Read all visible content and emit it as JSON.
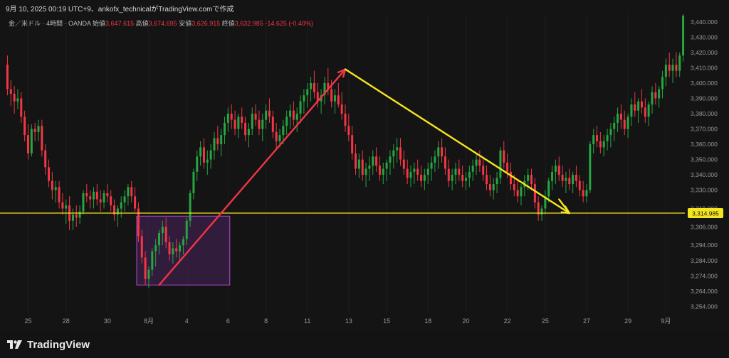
{
  "header": {
    "caption": "9月 10, 2025 00:19 UTC+9、ankofx_technicalがTradingView.comで作成"
  },
  "legend": {
    "symbol": "金／米ドル · 4時間 · OANDA",
    "open_label": "始値",
    "open": "3,647.615",
    "high_label": "高値",
    "high": "3,674.695",
    "low_label": "安値",
    "low": "3,626.915",
    "close_label": "終値",
    "close": "3,632.985",
    "change": "-14.625 (-0.40%)"
  },
  "footer": {
    "brand": "TradingView"
  },
  "colors": {
    "background": "#141414",
    "up": "#26a641",
    "down": "#f23645",
    "hline": "#f5e51f",
    "rise_arrow": "#f23645",
    "fall_arrow": "#f5e51f",
    "box_stroke": "#b04bd6",
    "box_fill": "#6a2a86"
  },
  "chart_data": {
    "type": "candlestick",
    "symbol": "XAUUSD",
    "timeframe": "4H",
    "ylim": [
      3250,
      3445
    ],
    "y_ticks": [
      "3,440.000",
      "3,430.000",
      "3,420.000",
      "3,410.000",
      "3,400.000",
      "3,390.000",
      "3,380.000",
      "3,370.000",
      "3,360.000",
      "3,350.000",
      "3,340.000",
      "3,330.000",
      "3,318.000",
      "3,306.000",
      "3,294.000",
      "3,284.000",
      "3,274.000",
      "3,264.000",
      "3,254.000"
    ],
    "x_ticks": [
      "25",
      "28",
      "30",
      "8月",
      "4",
      "6",
      "8",
      "11",
      "13",
      "15",
      "18",
      "20",
      "22",
      "25",
      "27",
      "29",
      "9月"
    ],
    "horizontal_line": {
      "value": 3314.985,
      "label": "3,314.985"
    },
    "highlight_box": {
      "from_candle": 38,
      "to_candle": 64,
      "y_from": 3268,
      "y_to": 3313
    },
    "arrows": [
      {
        "kind": "rise",
        "from_candle": 44,
        "from_value": 3268,
        "to_candle": 98,
        "to_value": 3409
      },
      {
        "kind": "fall",
        "from_candle": 98,
        "from_value": 3409,
        "to_candle": 163,
        "to_value": 3315
      },
      {
        "kind": "hook",
        "from_candle": 160,
        "from_value": 3324,
        "to_candle": 163,
        "to_value": 3315
      }
    ],
    "candles": [
      [
        3412,
        3418,
        3392,
        3396
      ],
      [
        3396,
        3402,
        3385,
        3393
      ],
      [
        3393,
        3398,
        3380,
        3388
      ],
      [
        3388,
        3396,
        3383,
        3390
      ],
      [
        3390,
        3394,
        3374,
        3378
      ],
      [
        3378,
        3382,
        3362,
        3366
      ],
      [
        3366,
        3373,
        3350,
        3354
      ],
      [
        3354,
        3373,
        3352,
        3370
      ],
      [
        3370,
        3374,
        3362,
        3368
      ],
      [
        3368,
        3376,
        3362,
        3372
      ],
      [
        3372,
        3376,
        3352,
        3356
      ],
      [
        3356,
        3360,
        3340,
        3345
      ],
      [
        3345,
        3350,
        3332,
        3336
      ],
      [
        3336,
        3342,
        3324,
        3330
      ],
      [
        3330,
        3336,
        3322,
        3332
      ],
      [
        3332,
        3336,
        3318,
        3322
      ],
      [
        3322,
        3328,
        3314,
        3318
      ],
      [
        3318,
        3324,
        3308,
        3320
      ],
      [
        3320,
        3326,
        3304,
        3310
      ],
      [
        3310,
        3318,
        3304,
        3314
      ],
      [
        3314,
        3320,
        3306,
        3312
      ],
      [
        3312,
        3320,
        3308,
        3316
      ],
      [
        3316,
        3330,
        3314,
        3328
      ],
      [
        3328,
        3334,
        3322,
        3326
      ],
      [
        3326,
        3330,
        3318,
        3324
      ],
      [
        3324,
        3332,
        3318,
        3329
      ],
      [
        3329,
        3334,
        3320,
        3324
      ],
      [
        3324,
        3330,
        3316,
        3322
      ],
      [
        3322,
        3330,
        3318,
        3328
      ],
      [
        3328,
        3334,
        3322,
        3326
      ],
      [
        3326,
        3330,
        3316,
        3320
      ],
      [
        3320,
        3324,
        3310,
        3314
      ],
      [
        3314,
        3320,
        3306,
        3318
      ],
      [
        3318,
        3326,
        3312,
        3322
      ],
      [
        3322,
        3330,
        3316,
        3326
      ],
      [
        3326,
        3334,
        3320,
        3332
      ],
      [
        3332,
        3336,
        3322,
        3326
      ],
      [
        3326,
        3332,
        3316,
        3318
      ],
      [
        3318,
        3322,
        3296,
        3300
      ],
      [
        3300,
        3304,
        3282,
        3286
      ],
      [
        3286,
        3290,
        3268,
        3272
      ],
      [
        3272,
        3280,
        3266,
        3278
      ],
      [
        3278,
        3292,
        3274,
        3290
      ],
      [
        3290,
        3298,
        3280,
        3294
      ],
      [
        3294,
        3304,
        3288,
        3302
      ],
      [
        3302,
        3310,
        3294,
        3306
      ],
      [
        3306,
        3312,
        3292,
        3296
      ],
      [
        3296,
        3300,
        3284,
        3288
      ],
      [
        3288,
        3296,
        3282,
        3292
      ],
      [
        3292,
        3298,
        3286,
        3290
      ],
      [
        3290,
        3296,
        3284,
        3294
      ],
      [
        3294,
        3300,
        3288,
        3298
      ],
      [
        3298,
        3312,
        3294,
        3310
      ],
      [
        3310,
        3330,
        3306,
        3328
      ],
      [
        3328,
        3344,
        3324,
        3342
      ],
      [
        3342,
        3356,
        3336,
        3352
      ],
      [
        3352,
        3362,
        3346,
        3358
      ],
      [
        3358,
        3364,
        3344,
        3348
      ],
      [
        3348,
        3356,
        3340,
        3350
      ],
      [
        3350,
        3360,
        3344,
        3356
      ],
      [
        3356,
        3368,
        3350,
        3364
      ],
      [
        3364,
        3372,
        3356,
        3360
      ],
      [
        3360,
        3370,
        3352,
        3366
      ],
      [
        3366,
        3378,
        3360,
        3374
      ],
      [
        3374,
        3384,
        3368,
        3380
      ],
      [
        3380,
        3386,
        3370,
        3376
      ],
      [
        3376,
        3382,
        3366,
        3370
      ],
      [
        3370,
        3380,
        3364,
        3378
      ],
      [
        3378,
        3384,
        3370,
        3374
      ],
      [
        3374,
        3378,
        3362,
        3366
      ],
      [
        3366,
        3374,
        3358,
        3370
      ],
      [
        3370,
        3384,
        3366,
        3380
      ],
      [
        3380,
        3386,
        3372,
        3376
      ],
      [
        3376,
        3382,
        3366,
        3370
      ],
      [
        3370,
        3380,
        3362,
        3376
      ],
      [
        3376,
        3386,
        3370,
        3382
      ],
      [
        3382,
        3390,
        3374,
        3378
      ],
      [
        3378,
        3382,
        3364,
        3368
      ],
      [
        3368,
        3374,
        3356,
        3362
      ],
      [
        3362,
        3370,
        3358,
        3366
      ],
      [
        3366,
        3376,
        3360,
        3372
      ],
      [
        3372,
        3382,
        3366,
        3378
      ],
      [
        3378,
        3386,
        3370,
        3382
      ],
      [
        3382,
        3388,
        3372,
        3376
      ],
      [
        3376,
        3384,
        3368,
        3380
      ],
      [
        3380,
        3392,
        3374,
        3388
      ],
      [
        3388,
        3396,
        3380,
        3392
      ],
      [
        3392,
        3400,
        3384,
        3396
      ],
      [
        3396,
        3404,
        3388,
        3400
      ],
      [
        3400,
        3408,
        3390,
        3394
      ],
      [
        3394,
        3400,
        3384,
        3388
      ],
      [
        3388,
        3396,
        3380,
        3392
      ],
      [
        3392,
        3404,
        3386,
        3400
      ],
      [
        3400,
        3410,
        3392,
        3396
      ],
      [
        3396,
        3402,
        3384,
        3388
      ],
      [
        3388,
        3396,
        3380,
        3392
      ],
      [
        3392,
        3400,
        3384,
        3386
      ],
      [
        3386,
        3394,
        3376,
        3380
      ],
      [
        3380,
        3386,
        3368,
        3372
      ],
      [
        3372,
        3380,
        3362,
        3366
      ],
      [
        3366,
        3372,
        3350,
        3354
      ],
      [
        3354,
        3360,
        3340,
        3344
      ],
      [
        3344,
        3354,
        3338,
        3350
      ],
      [
        3350,
        3356,
        3336,
        3340
      ],
      [
        3340,
        3348,
        3332,
        3344
      ],
      [
        3344,
        3352,
        3336,
        3346
      ],
      [
        3346,
        3356,
        3340,
        3352
      ],
      [
        3352,
        3358,
        3342,
        3346
      ],
      [
        3346,
        3352,
        3336,
        3340
      ],
      [
        3340,
        3348,
        3334,
        3344
      ],
      [
        3344,
        3350,
        3336,
        3348
      ],
      [
        3348,
        3356,
        3340,
        3352
      ],
      [
        3352,
        3360,
        3344,
        3356
      ],
      [
        3356,
        3364,
        3348,
        3358
      ],
      [
        3358,
        3364,
        3346,
        3350
      ],
      [
        3350,
        3356,
        3340,
        3344
      ],
      [
        3344,
        3350,
        3334,
        3338
      ],
      [
        3338,
        3346,
        3332,
        3342
      ],
      [
        3342,
        3348,
        3334,
        3344
      ],
      [
        3344,
        3350,
        3336,
        3340
      ],
      [
        3340,
        3346,
        3332,
        3336
      ],
      [
        3336,
        3344,
        3330,
        3340
      ],
      [
        3340,
        3348,
        3334,
        3344
      ],
      [
        3344,
        3352,
        3336,
        3348
      ],
      [
        3348,
        3356,
        3342,
        3352
      ],
      [
        3352,
        3362,
        3344,
        3358
      ],
      [
        3358,
        3364,
        3348,
        3352
      ],
      [
        3352,
        3358,
        3340,
        3344
      ],
      [
        3344,
        3350,
        3332,
        3336
      ],
      [
        3336,
        3344,
        3330,
        3340
      ],
      [
        3340,
        3348,
        3334,
        3344
      ],
      [
        3344,
        3350,
        3336,
        3340
      ],
      [
        3340,
        3346,
        3332,
        3336
      ],
      [
        3336,
        3342,
        3330,
        3338
      ],
      [
        3338,
        3346,
        3332,
        3342
      ],
      [
        3342,
        3350,
        3336,
        3346
      ],
      [
        3346,
        3354,
        3340,
        3350
      ],
      [
        3350,
        3356,
        3342,
        3346
      ],
      [
        3346,
        3352,
        3336,
        3340
      ],
      [
        3340,
        3346,
        3330,
        3334
      ],
      [
        3334,
        3340,
        3326,
        3330
      ],
      [
        3330,
        3338,
        3324,
        3334
      ],
      [
        3334,
        3342,
        3328,
        3338
      ],
      [
        3338,
        3358,
        3334,
        3356
      ],
      [
        3356,
        3362,
        3344,
        3348
      ],
      [
        3348,
        3354,
        3338,
        3342
      ],
      [
        3342,
        3348,
        3330,
        3334
      ],
      [
        3334,
        3340,
        3326,
        3330
      ],
      [
        3330,
        3336,
        3322,
        3326
      ],
      [
        3326,
        3334,
        3320,
        3332
      ],
      [
        3332,
        3340,
        3326,
        3336
      ],
      [
        3336,
        3344,
        3330,
        3340
      ],
      [
        3340,
        3344,
        3330,
        3334
      ],
      [
        3334,
        3338,
        3318,
        3322
      ],
      [
        3322,
        3326,
        3310,
        3314
      ],
      [
        3314,
        3320,
        3310,
        3318
      ],
      [
        3318,
        3330,
        3314,
        3326
      ],
      [
        3326,
        3338,
        3322,
        3336
      ],
      [
        3336,
        3346,
        3330,
        3342
      ],
      [
        3342,
        3350,
        3334,
        3346
      ],
      [
        3346,
        3352,
        3336,
        3340
      ],
      [
        3340,
        3346,
        3332,
        3336
      ],
      [
        3336,
        3342,
        3328,
        3338
      ],
      [
        3338,
        3344,
        3330,
        3334
      ],
      [
        3334,
        3342,
        3328,
        3340
      ],
      [
        3340,
        3346,
        3332,
        3336
      ],
      [
        3336,
        3340,
        3326,
        3330
      ],
      [
        3330,
        3336,
        3322,
        3326
      ],
      [
        3326,
        3334,
        3322,
        3330
      ],
      [
        3330,
        3362,
        3328,
        3360
      ],
      [
        3360,
        3370,
        3354,
        3366
      ],
      [
        3366,
        3372,
        3358,
        3362
      ],
      [
        3362,
        3368,
        3354,
        3358
      ],
      [
        3358,
        3366,
        3352,
        3362
      ],
      [
        3362,
        3370,
        3356,
        3366
      ],
      [
        3366,
        3374,
        3358,
        3370
      ],
      [
        3370,
        3378,
        3362,
        3374
      ],
      [
        3374,
        3384,
        3368,
        3380
      ],
      [
        3380,
        3386,
        3370,
        3376
      ],
      [
        3376,
        3382,
        3366,
        3370
      ],
      [
        3370,
        3380,
        3364,
        3378
      ],
      [
        3378,
        3390,
        3372,
        3386
      ],
      [
        3386,
        3394,
        3378,
        3382
      ],
      [
        3382,
        3390,
        3374,
        3388
      ],
      [
        3388,
        3396,
        3380,
        3384
      ],
      [
        3384,
        3390,
        3374,
        3378
      ],
      [
        3378,
        3388,
        3372,
        3386
      ],
      [
        3386,
        3398,
        3380,
        3394
      ],
      [
        3394,
        3400,
        3386,
        3390
      ],
      [
        3390,
        3398,
        3384,
        3396
      ],
      [
        3396,
        3408,
        3390,
        3404
      ],
      [
        3404,
        3416,
        3398,
        3412
      ],
      [
        3412,
        3420,
        3404,
        3408
      ],
      [
        3408,
        3416,
        3400,
        3412
      ],
      [
        3412,
        3420,
        3404,
        3408
      ],
      [
        3408,
        3420,
        3404,
        3418
      ],
      [
        3418,
        3448,
        3414,
        3444
      ]
    ]
  }
}
